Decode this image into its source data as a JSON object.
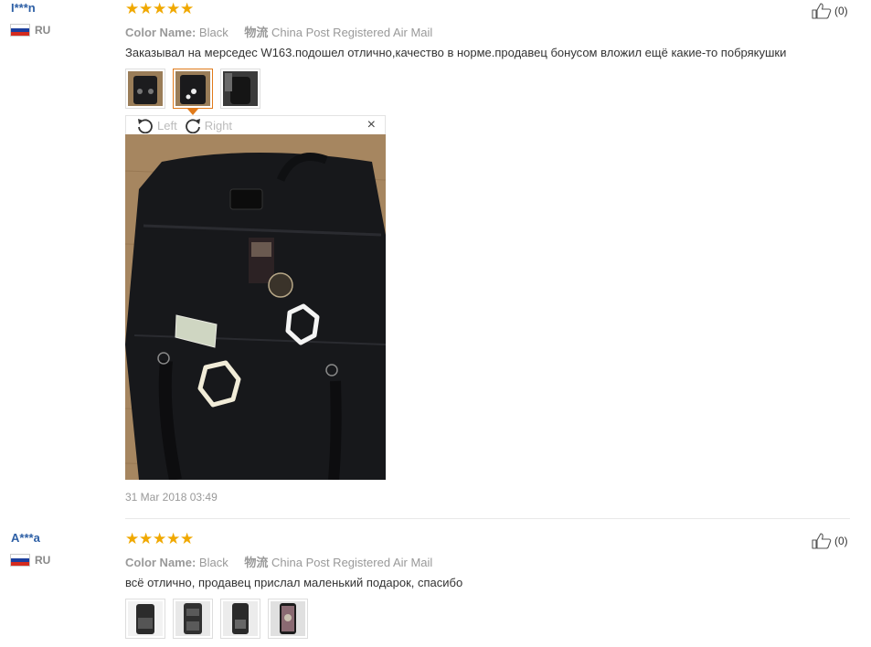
{
  "reviews": [
    {
      "user": "I***n",
      "country": "RU",
      "rating": 5,
      "color_label": "Color Name:",
      "color_value": "Black",
      "shipping_label": "物流",
      "shipping_value": "China Post Registered Air Mail",
      "text": "Заказывал на мерседес W163.подошел отлично,качество в норме.продавец бонусом вложил ещё какие-то побрякушки",
      "helpful_count": "(0)",
      "thumbnail_count": 3,
      "selected_thumbnail": 2,
      "viewer": {
        "rotate_left": "Left",
        "rotate_right": "Right",
        "close": "×"
      },
      "date": "31 Mar 2018 03:49"
    },
    {
      "user": "A***a",
      "country": "RU",
      "rating": 5,
      "color_label": "Color Name:",
      "color_value": "Black",
      "shipping_label": "物流",
      "shipping_value": "China Post Registered Air Mail",
      "text": "всё отлично, продавец прислал маленький подарок, спасибо",
      "helpful_count": "(0)",
      "thumbnail_count": 4
    }
  ],
  "colors": {
    "username": "#2d5fa5",
    "star": "#f0a800",
    "selected_thumb_border": "#e07a1a"
  }
}
